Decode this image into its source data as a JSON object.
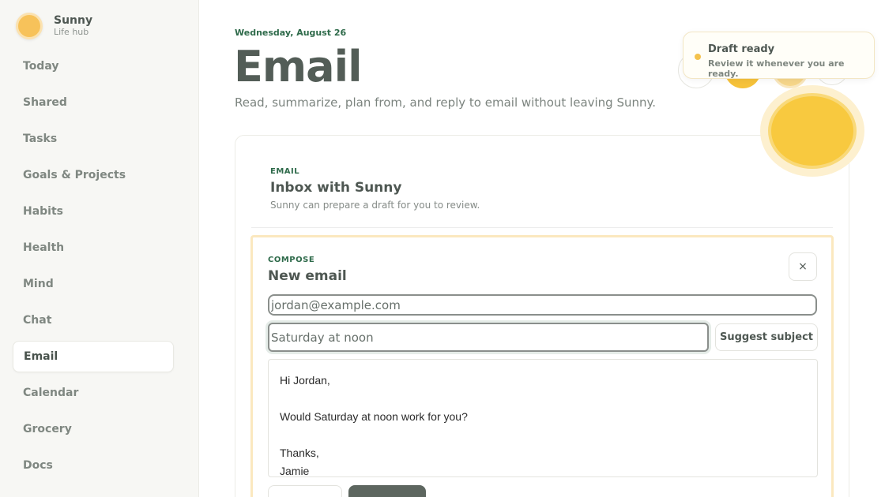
{
  "brand": {
    "name": "Sunny",
    "subtitle": "Life hub"
  },
  "nav": [
    {
      "label": "Today"
    },
    {
      "label": "Shared"
    },
    {
      "label": "Tasks"
    },
    {
      "label": "Goals & Projects"
    },
    {
      "label": "Habits"
    },
    {
      "label": "Health"
    },
    {
      "label": "Mind"
    },
    {
      "label": "Chat"
    },
    {
      "label": "Email",
      "active": true
    },
    {
      "label": "Calendar"
    },
    {
      "label": "Grocery"
    },
    {
      "label": "Docs"
    }
  ],
  "header": {
    "date": "Wednesday, August 26",
    "title": "Email",
    "description": "Read, summarize, plan from, and reply to email without leaving Sunny."
  },
  "card": {
    "eyebrow": "EMAIL",
    "title": "Inbox with Sunny",
    "subtitle": "Sunny can prepare a draft for you to review."
  },
  "compose": {
    "eyebrow": "COMPOSE",
    "title": "New email",
    "close_label": "×",
    "to_value": "jordan@example.com",
    "subject_value": "Saturday at noon",
    "suggest_label": "Suggest subject",
    "body": {
      "greeting": "Hi Jordan,",
      "line1": "Would Saturday at noon work for you?",
      "closing": "Thanks,",
      "signature": "Jamie"
    }
  },
  "toast": {
    "title": "Draft ready",
    "message": "Review it whenever you are ready."
  },
  "colors": {
    "accent_green": "#2e6a4a",
    "sun_yellow": "#f8c93f",
    "compose_border": "#fbe8bf"
  }
}
